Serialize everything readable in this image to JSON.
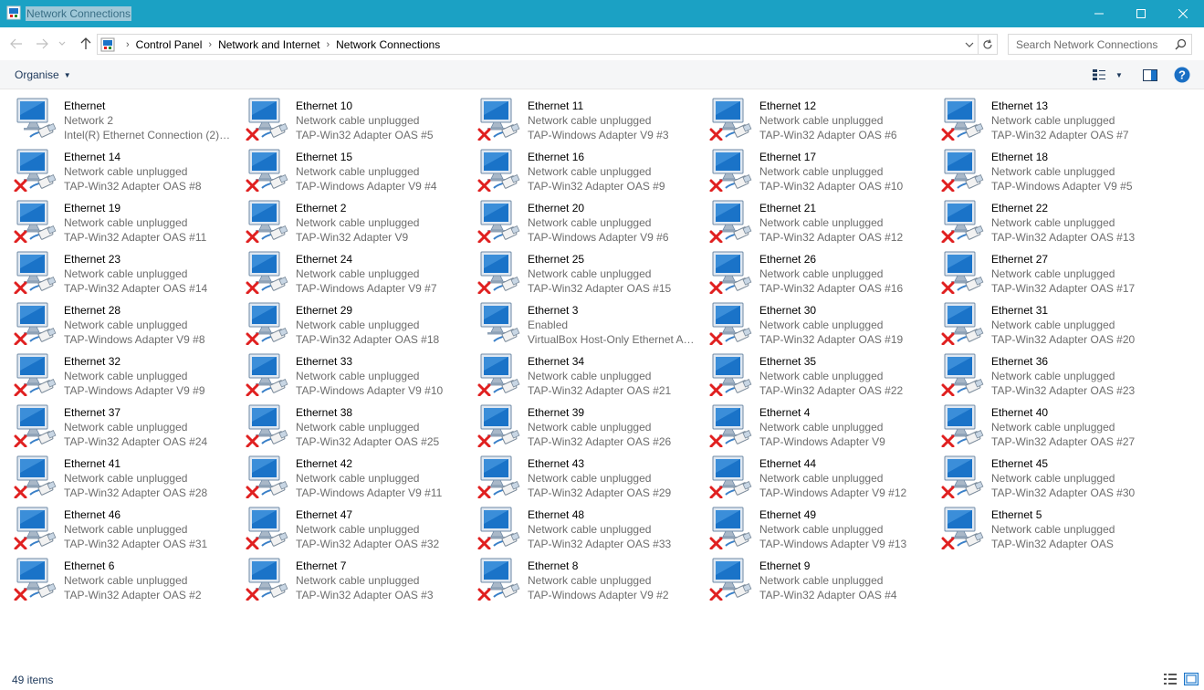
{
  "window": {
    "title": "Network Connections",
    "accent_color": "#1ba1c4"
  },
  "titlebar_icons": [
    "network-connections-icon",
    "minimize-icon",
    "maximize-icon",
    "close-icon"
  ],
  "address": {
    "breadcrumb": [
      "Control Panel",
      "Network and Internet",
      "Network Connections"
    ],
    "search_placeholder": "Search Network Connections"
  },
  "toolbar": {
    "organise_label": "Organise"
  },
  "items": [
    {
      "name": "Ethernet",
      "status": "Network  2",
      "adapter": "Intel(R) Ethernet Connection (2) I...",
      "unplugged": false
    },
    {
      "name": "Ethernet 10",
      "status": "Network cable unplugged",
      "adapter": "TAP-Win32 Adapter OAS #5",
      "unplugged": true
    },
    {
      "name": "Ethernet 11",
      "status": "Network cable unplugged",
      "adapter": "TAP-Windows Adapter V9 #3",
      "unplugged": true
    },
    {
      "name": "Ethernet 12",
      "status": "Network cable unplugged",
      "adapter": "TAP-Win32 Adapter OAS #6",
      "unplugged": true
    },
    {
      "name": "Ethernet 13",
      "status": "Network cable unplugged",
      "adapter": "TAP-Win32 Adapter OAS #7",
      "unplugged": true
    },
    {
      "name": "Ethernet 14",
      "status": "Network cable unplugged",
      "adapter": "TAP-Win32 Adapter OAS #8",
      "unplugged": true
    },
    {
      "name": "Ethernet 15",
      "status": "Network cable unplugged",
      "adapter": "TAP-Windows Adapter V9 #4",
      "unplugged": true
    },
    {
      "name": "Ethernet 16",
      "status": "Network cable unplugged",
      "adapter": "TAP-Win32 Adapter OAS #9",
      "unplugged": true
    },
    {
      "name": "Ethernet 17",
      "status": "Network cable unplugged",
      "adapter": "TAP-Win32 Adapter OAS #10",
      "unplugged": true
    },
    {
      "name": "Ethernet 18",
      "status": "Network cable unplugged",
      "adapter": "TAP-Windows Adapter V9 #5",
      "unplugged": true
    },
    {
      "name": "Ethernet 19",
      "status": "Network cable unplugged",
      "adapter": "TAP-Win32 Adapter OAS #11",
      "unplugged": true
    },
    {
      "name": "Ethernet 2",
      "status": "Network cable unplugged",
      "adapter": "TAP-Win32 Adapter V9",
      "unplugged": true
    },
    {
      "name": "Ethernet 20",
      "status": "Network cable unplugged",
      "adapter": "TAP-Windows Adapter V9 #6",
      "unplugged": true
    },
    {
      "name": "Ethernet 21",
      "status": "Network cable unplugged",
      "adapter": "TAP-Win32 Adapter OAS #12",
      "unplugged": true
    },
    {
      "name": "Ethernet 22",
      "status": "Network cable unplugged",
      "adapter": "TAP-Win32 Adapter OAS #13",
      "unplugged": true
    },
    {
      "name": "Ethernet 23",
      "status": "Network cable unplugged",
      "adapter": "TAP-Win32 Adapter OAS #14",
      "unplugged": true
    },
    {
      "name": "Ethernet 24",
      "status": "Network cable unplugged",
      "adapter": "TAP-Windows Adapter V9 #7",
      "unplugged": true
    },
    {
      "name": "Ethernet 25",
      "status": "Network cable unplugged",
      "adapter": "TAP-Win32 Adapter OAS #15",
      "unplugged": true
    },
    {
      "name": "Ethernet 26",
      "status": "Network cable unplugged",
      "adapter": "TAP-Win32 Adapter OAS #16",
      "unplugged": true
    },
    {
      "name": "Ethernet 27",
      "status": "Network cable unplugged",
      "adapter": "TAP-Win32 Adapter OAS #17",
      "unplugged": true
    },
    {
      "name": "Ethernet 28",
      "status": "Network cable unplugged",
      "adapter": "TAP-Windows Adapter V9 #8",
      "unplugged": true
    },
    {
      "name": "Ethernet 29",
      "status": "Network cable unplugged",
      "adapter": "TAP-Win32 Adapter OAS #18",
      "unplugged": true
    },
    {
      "name": "Ethernet 3",
      "status": "Enabled",
      "adapter": "VirtualBox Host-Only Ethernet Ad...",
      "unplugged": false
    },
    {
      "name": "Ethernet 30",
      "status": "Network cable unplugged",
      "adapter": "TAP-Win32 Adapter OAS #19",
      "unplugged": true
    },
    {
      "name": "Ethernet 31",
      "status": "Network cable unplugged",
      "adapter": "TAP-Win32 Adapter OAS #20",
      "unplugged": true
    },
    {
      "name": "Ethernet 32",
      "status": "Network cable unplugged",
      "adapter": "TAP-Windows Adapter V9 #9",
      "unplugged": true
    },
    {
      "name": "Ethernet 33",
      "status": "Network cable unplugged",
      "adapter": "TAP-Windows Adapter V9 #10",
      "unplugged": true
    },
    {
      "name": "Ethernet 34",
      "status": "Network cable unplugged",
      "adapter": "TAP-Win32 Adapter OAS #21",
      "unplugged": true
    },
    {
      "name": "Ethernet 35",
      "status": "Network cable unplugged",
      "adapter": "TAP-Win32 Adapter OAS #22",
      "unplugged": true
    },
    {
      "name": "Ethernet 36",
      "status": "Network cable unplugged",
      "adapter": "TAP-Win32 Adapter OAS #23",
      "unplugged": true
    },
    {
      "name": "Ethernet 37",
      "status": "Network cable unplugged",
      "adapter": "TAP-Win32 Adapter OAS #24",
      "unplugged": true
    },
    {
      "name": "Ethernet 38",
      "status": "Network cable unplugged",
      "adapter": "TAP-Win32 Adapter OAS #25",
      "unplugged": true
    },
    {
      "name": "Ethernet 39",
      "status": "Network cable unplugged",
      "adapter": "TAP-Win32 Adapter OAS #26",
      "unplugged": true
    },
    {
      "name": "Ethernet 4",
      "status": "Network cable unplugged",
      "adapter": "TAP-Windows Adapter V9",
      "unplugged": true
    },
    {
      "name": "Ethernet 40",
      "status": "Network cable unplugged",
      "adapter": "TAP-Win32 Adapter OAS #27",
      "unplugged": true
    },
    {
      "name": "Ethernet 41",
      "status": "Network cable unplugged",
      "adapter": "TAP-Win32 Adapter OAS #28",
      "unplugged": true
    },
    {
      "name": "Ethernet 42",
      "status": "Network cable unplugged",
      "adapter": "TAP-Windows Adapter V9 #11",
      "unplugged": true
    },
    {
      "name": "Ethernet 43",
      "status": "Network cable unplugged",
      "adapter": "TAP-Win32 Adapter OAS #29",
      "unplugged": true
    },
    {
      "name": "Ethernet 44",
      "status": "Network cable unplugged",
      "adapter": "TAP-Windows Adapter V9 #12",
      "unplugged": true
    },
    {
      "name": "Ethernet 45",
      "status": "Network cable unplugged",
      "adapter": "TAP-Win32 Adapter OAS #30",
      "unplugged": true
    },
    {
      "name": "Ethernet 46",
      "status": "Network cable unplugged",
      "adapter": "TAP-Win32 Adapter OAS #31",
      "unplugged": true
    },
    {
      "name": "Ethernet 47",
      "status": "Network cable unplugged",
      "adapter": "TAP-Win32 Adapter OAS #32",
      "unplugged": true
    },
    {
      "name": "Ethernet 48",
      "status": "Network cable unplugged",
      "adapter": "TAP-Win32 Adapter OAS #33",
      "unplugged": true
    },
    {
      "name": "Ethernet 49",
      "status": "Network cable unplugged",
      "adapter": "TAP-Windows Adapter V9 #13",
      "unplugged": true
    },
    {
      "name": "Ethernet 5",
      "status": "Network cable unplugged",
      "adapter": "TAP-Win32 Adapter OAS",
      "unplugged": true
    },
    {
      "name": "Ethernet 6",
      "status": "Network cable unplugged",
      "adapter": "TAP-Win32 Adapter OAS #2",
      "unplugged": true
    },
    {
      "name": "Ethernet 7",
      "status": "Network cable unplugged",
      "adapter": "TAP-Win32 Adapter OAS #3",
      "unplugged": true
    },
    {
      "name": "Ethernet 8",
      "status": "Network cable unplugged",
      "adapter": "TAP-Windows Adapter V9 #2",
      "unplugged": true
    },
    {
      "name": "Ethernet 9",
      "status": "Network cable unplugged",
      "adapter": "TAP-Win32 Adapter OAS #4",
      "unplugged": true
    }
  ],
  "status_bar": {
    "item_count": "49 items"
  },
  "colors": {
    "unplugged_x": "#e02020",
    "monitor_blue": "#1a73c8",
    "secondary_text": "#6d6d6d"
  }
}
